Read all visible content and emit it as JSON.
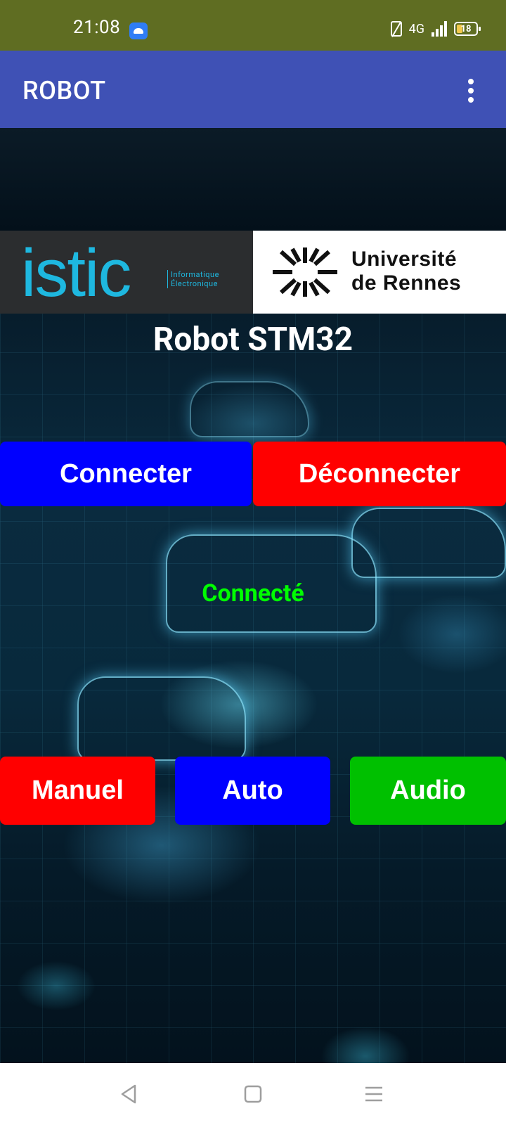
{
  "status_bar": {
    "time": "21:08",
    "network": "4G",
    "battery_level": "18"
  },
  "app_bar": {
    "title": "ROBOT"
  },
  "logos": {
    "istic": {
      "word": "istic",
      "sub_line1": "Informatique",
      "sub_line2": "Électronique"
    },
    "university": {
      "line1": "Université",
      "line2": "de Rennes"
    }
  },
  "main": {
    "title": "Robot STM32",
    "connect_label": "Connecter",
    "disconnect_label": "Déconnecter",
    "connection_status": "Connecté",
    "modes": {
      "manual": "Manuel",
      "auto": "Auto",
      "audio": "Audio"
    }
  },
  "colors": {
    "status_bar_bg": "#5f6d22",
    "app_bar_bg": "#3f51b5",
    "connect_bg": "#0000ff",
    "disconnect_bg": "#ff0000",
    "status_text": "#00ff00",
    "manual_bg": "#ff0000",
    "auto_bg": "#0000ff",
    "audio_bg": "#00c000"
  },
  "icons": {
    "status": [
      "android-icon",
      "nfc-icon",
      "signal-icon",
      "battery-icon"
    ],
    "app_bar": [
      "more-vert-icon"
    ],
    "nav": [
      "back-icon",
      "home-icon",
      "recents-icon"
    ]
  }
}
